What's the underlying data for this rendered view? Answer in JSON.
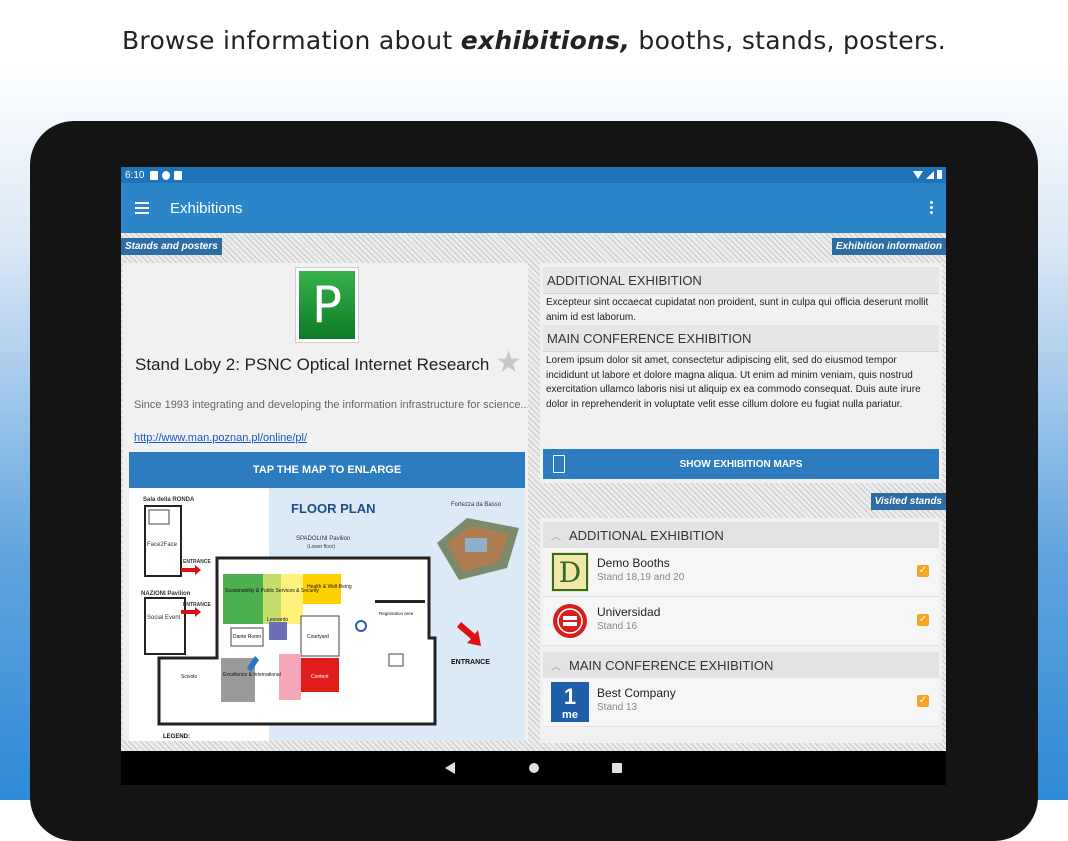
{
  "headline": {
    "before": "Browse information about ",
    "emphasis": "exhibitions,",
    "after": " booths, stands, posters."
  },
  "status_bar": {
    "time": "6:10"
  },
  "app_bar": {
    "title": "Exhibitions"
  },
  "left": {
    "tag": "Stands and posters",
    "stand_logo_letter": "P",
    "stand_name": "Stand Loby 2: PSNC Optical Internet Research",
    "description": "Since 1993 integrating and developing the information infrastructure for science...",
    "link": "http://www.man.poznan.pl/online/pl/",
    "enlarge_button": "TAP THE MAP TO ENLARGE",
    "floor_plan": {
      "title": "FLOOR PLAN",
      "sala_ronda": "Sala della RONDA",
      "fortezza": "Fortezza da Basso",
      "spadolini": "SPADOLINI Pavilion",
      "lower_floor": "(Lower floor)",
      "face2face": "Face2Face",
      "nazioni": "NAZIONI Pavilion",
      "social_event": "Social Event",
      "entrance1": "ENTRANCE",
      "entrance2": "ENTRANCE",
      "entrance3": "ENTRANCE",
      "sustainability": "Sustainability & Public Services & Security",
      "health": "Health & Well-Being",
      "dante": "Dante Room",
      "leonardo": "Leonardo",
      "courtyard": "Courtyard",
      "registration": "Registration area",
      "sviluppo": "Scivolo",
      "excellence": "Excellence & International",
      "content": "Content",
      "legend": "LEGEND:"
    }
  },
  "exhibition_info": {
    "tag": "Exhibition information",
    "sections": [
      {
        "title": "ADDITIONAL EXHIBITION",
        "body": "Excepteur sint occaecat cupidatat non proident, sunt in culpa qui officia deserunt mollit anim id est laborum."
      },
      {
        "title": "MAIN CONFERENCE EXHIBITION",
        "body": "Lorem ipsum dolor sit amet, consectetur adipiscing elit, sed do eiusmod tempor incididunt ut labore et dolore magna aliqua. Ut enim ad minim veniam, quis nostrud exercitation ullamco laboris nisi ut aliquip ex ea commodo consequat. Duis aute irure dolor in reprehenderit in voluptate velit esse cillum dolore eu fugiat nulla pariatur."
      }
    ],
    "maps_button": "SHOW EXHIBITION MAPS"
  },
  "visited": {
    "tag": "Visited stands",
    "groups": [
      {
        "title": "ADDITIONAL EXHIBITION",
        "items": [
          {
            "name": "Demo Booths",
            "sub": "Stand 18,19 and 20",
            "checked": true
          },
          {
            "name": "Universidad",
            "sub": "Stand 16",
            "checked": true
          }
        ]
      },
      {
        "title": "MAIN CONFERENCE EXHIBITION",
        "items": [
          {
            "name": "Best Company",
            "sub": "Stand 13",
            "checked": true
          }
        ]
      }
    ]
  },
  "colors": {
    "primary": "#2a86c8",
    "status_bar": "#1f74b9",
    "button": "#2e7cc0",
    "tag": "#2e6da4",
    "checkbox": "#f5a623"
  }
}
